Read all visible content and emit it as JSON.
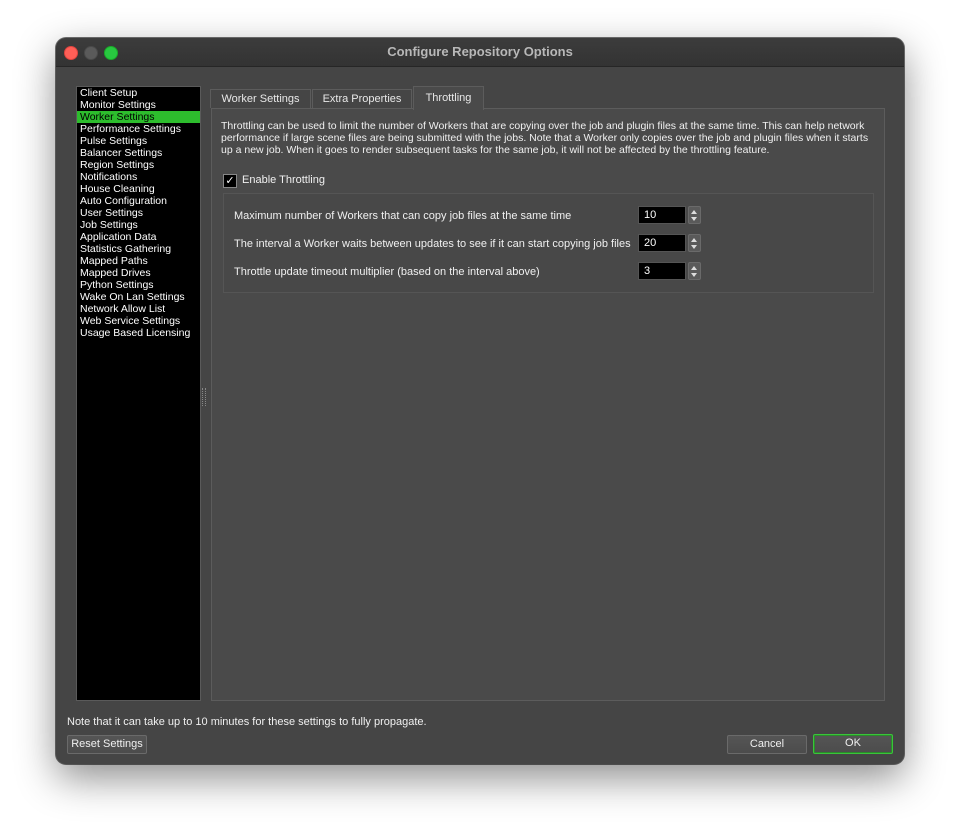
{
  "window": {
    "title": "Configure Repository Options"
  },
  "sidebar": {
    "items": [
      {
        "label": "Client Setup",
        "selected": false
      },
      {
        "label": "Monitor Settings",
        "selected": false
      },
      {
        "label": "Worker Settings",
        "selected": true
      },
      {
        "label": "Performance Settings",
        "selected": false
      },
      {
        "label": "Pulse Settings",
        "selected": false
      },
      {
        "label": "Balancer Settings",
        "selected": false
      },
      {
        "label": "Region Settings",
        "selected": false
      },
      {
        "label": "Notifications",
        "selected": false
      },
      {
        "label": "House Cleaning",
        "selected": false
      },
      {
        "label": "Auto Configuration",
        "selected": false
      },
      {
        "label": "User Settings",
        "selected": false
      },
      {
        "label": "Job Settings",
        "selected": false
      },
      {
        "label": "Application Data",
        "selected": false
      },
      {
        "label": "Statistics Gathering",
        "selected": false
      },
      {
        "label": "Mapped Paths",
        "selected": false
      },
      {
        "label": "Mapped Drives",
        "selected": false
      },
      {
        "label": "Python Settings",
        "selected": false
      },
      {
        "label": "Wake On Lan Settings",
        "selected": false
      },
      {
        "label": "Network Allow List",
        "selected": false
      },
      {
        "label": "Web Service Settings",
        "selected": false
      },
      {
        "label": "Usage Based Licensing",
        "selected": false
      }
    ]
  },
  "tabs": [
    {
      "label": "Worker Settings",
      "active": false
    },
    {
      "label": "Extra Properties",
      "active": false
    },
    {
      "label": "Throttling",
      "active": true
    }
  ],
  "throttling": {
    "description": "Throttling can be used to limit the number of Workers that are copying over the job and plugin files at the same time. This can help network performance if large scene files are being submitted with the jobs. Note that a Worker only copies over the job and plugin files when it starts up a new job. When it goes to render subsequent tasks for the same job, it will not be affected by the throttling feature.",
    "enable_label": "Enable Throttling",
    "enable_checked": true,
    "check_glyph": "✓",
    "fields": [
      {
        "label": "Maximum number of Workers that can copy job files at the same time",
        "value": "10"
      },
      {
        "label": "The interval a Worker waits between updates to see if it can start copying job files",
        "value": "20"
      },
      {
        "label": "Throttle update timeout multiplier (based on the interval above)",
        "value": "3"
      }
    ]
  },
  "footer": {
    "note": "Note that it can take up to 10 minutes for these settings to fully propagate.",
    "reset_label": "Reset Settings",
    "cancel_label": "Cancel",
    "ok_label": "OK"
  },
  "colors": {
    "selection": "#2dbd2d",
    "window_bg": "#454545",
    "close": "#fe5f57",
    "maximize": "#28c840"
  }
}
